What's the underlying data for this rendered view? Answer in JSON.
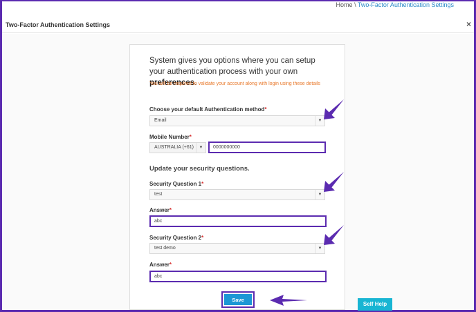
{
  "breadcrumb": {
    "home": "Home",
    "separator": "\\",
    "current": "Two-Factor Authentication Settings"
  },
  "modal": {
    "title": "Two-Factor Authentication Settings",
    "close": "×"
  },
  "intro": {
    "text": "System gives you options where you can setup your authentication process with your own ",
    "emphasis": "preferences",
    "suffix": ".",
    "note": "You will be required to validate your account along with login using these details"
  },
  "auth_method": {
    "label": "Choose your default Authentication method",
    "required": "*",
    "value": "Email"
  },
  "mobile": {
    "label": "Mobile Number",
    "required": "*",
    "country": "AUSTRALIA (+61)",
    "number": "0000000000"
  },
  "security": {
    "heading": "Update your security questions.",
    "q1_label": "Security Question 1",
    "q1_value": "test",
    "a1_label": "Answer",
    "a1_value": "abc",
    "q2_label": "Security Question 2",
    "q2_value": "test demo",
    "a2_label": "Answer",
    "a2_value": "abc",
    "required": "*"
  },
  "actions": {
    "save": "Save",
    "self_help": "Self Help"
  },
  "colors": {
    "accent": "#5b2bb0",
    "primary_button": "#1b97d5",
    "help_button": "#18b5d3",
    "note": "#e8782a"
  },
  "icons": {
    "dropdown": "chevron-down-icon",
    "annotation": "arrow-icon"
  }
}
